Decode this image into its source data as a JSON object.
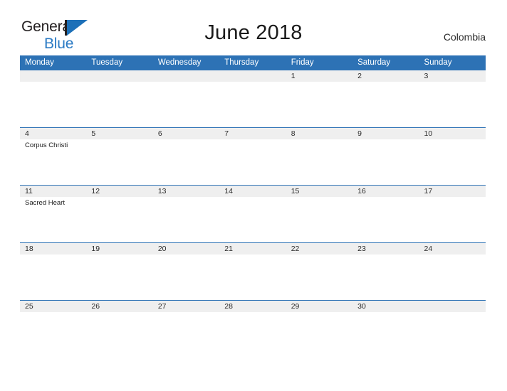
{
  "brand": {
    "word1": "General",
    "word2": "Blue",
    "flag_icon": "flag-triangle-icon",
    "color_dark": "#231f20",
    "color_blue": "#2a7ac4"
  },
  "header": {
    "title": "June 2018",
    "country": "Colombia"
  },
  "calendar": {
    "accent_color": "#2d72b5",
    "day_band_color": "#efefef",
    "weekdays": [
      "Monday",
      "Tuesday",
      "Wednesday",
      "Thursday",
      "Friday",
      "Saturday",
      "Sunday"
    ],
    "weeks": [
      [
        {
          "date": "",
          "events": []
        },
        {
          "date": "",
          "events": []
        },
        {
          "date": "",
          "events": []
        },
        {
          "date": "",
          "events": []
        },
        {
          "date": "1",
          "events": []
        },
        {
          "date": "2",
          "events": []
        },
        {
          "date": "3",
          "events": []
        }
      ],
      [
        {
          "date": "4",
          "events": [
            "Corpus Christi"
          ]
        },
        {
          "date": "5",
          "events": []
        },
        {
          "date": "6",
          "events": []
        },
        {
          "date": "7",
          "events": []
        },
        {
          "date": "8",
          "events": []
        },
        {
          "date": "9",
          "events": []
        },
        {
          "date": "10",
          "events": []
        }
      ],
      [
        {
          "date": "11",
          "events": [
            "Sacred Heart"
          ]
        },
        {
          "date": "12",
          "events": []
        },
        {
          "date": "13",
          "events": []
        },
        {
          "date": "14",
          "events": []
        },
        {
          "date": "15",
          "events": []
        },
        {
          "date": "16",
          "events": []
        },
        {
          "date": "17",
          "events": []
        }
      ],
      [
        {
          "date": "18",
          "events": []
        },
        {
          "date": "19",
          "events": []
        },
        {
          "date": "20",
          "events": []
        },
        {
          "date": "21",
          "events": []
        },
        {
          "date": "22",
          "events": []
        },
        {
          "date": "23",
          "events": []
        },
        {
          "date": "24",
          "events": []
        }
      ],
      [
        {
          "date": "25",
          "events": []
        },
        {
          "date": "26",
          "events": []
        },
        {
          "date": "27",
          "events": []
        },
        {
          "date": "28",
          "events": []
        },
        {
          "date": "29",
          "events": []
        },
        {
          "date": "30",
          "events": []
        },
        {
          "date": "",
          "events": []
        }
      ]
    ]
  }
}
